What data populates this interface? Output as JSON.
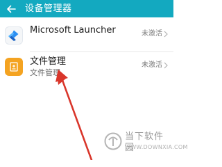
{
  "header": {
    "title": "设备管理器",
    "back_icon": "arrow-left-icon",
    "background": "#13a9c0"
  },
  "apps": [
    {
      "name": "Microsoft Launcher",
      "status": "未激活",
      "icon": "microsoft-launcher-icon"
    },
    {
      "name": "文件管理",
      "subtitle": "文件管理",
      "status": "未激活",
      "icon": "file-manager-icon",
      "icon_color": "#f4a321"
    }
  ],
  "annotation": {
    "type": "red-arrow",
    "color": "#d9362b"
  },
  "watermark": {
    "text": "当下软件园",
    "url": "WWW.DOWNXIA.COM"
  }
}
